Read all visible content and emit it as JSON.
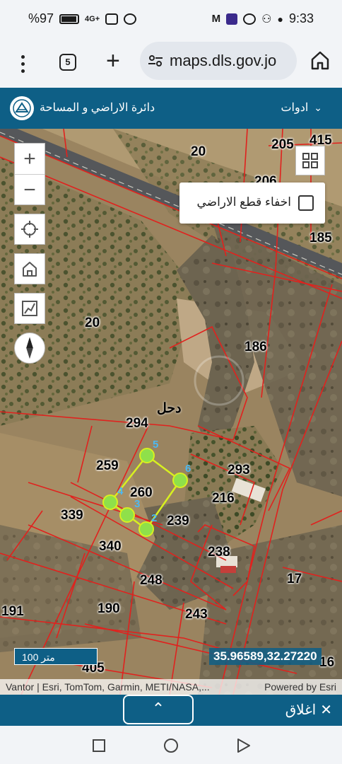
{
  "status": {
    "left": "%97",
    "time": "9:33",
    "network": "4G+"
  },
  "browser": {
    "url": "maps.dls.gov.jo",
    "tab_count": "5"
  },
  "header": {
    "title": "دائرة الاراضي و المساحة",
    "tools_label": "ادوات"
  },
  "panel": {
    "hide_label": "اخفاء قطع الاراضي"
  },
  "map": {
    "town": "دحل",
    "parcels": [
      "20",
      "205",
      "415",
      "206",
      "185",
      "186",
      "20",
      "294",
      "259",
      "260",
      "293",
      "216",
      "339",
      "239",
      "340",
      "238",
      "248",
      "17",
      "191",
      "190",
      "243",
      "405",
      "16"
    ],
    "vertices": [
      "5",
      "6",
      "4",
      "3",
      "2"
    ],
    "scale": "100 متر",
    "coordinates": "35.96589,32.27220",
    "attribution": "Vantor | Esri, TomTom, Garmin, METI/NASA,...",
    "powered_by": "Powered by Esri"
  },
  "bottom": {
    "close_label": "اغلاق"
  }
}
